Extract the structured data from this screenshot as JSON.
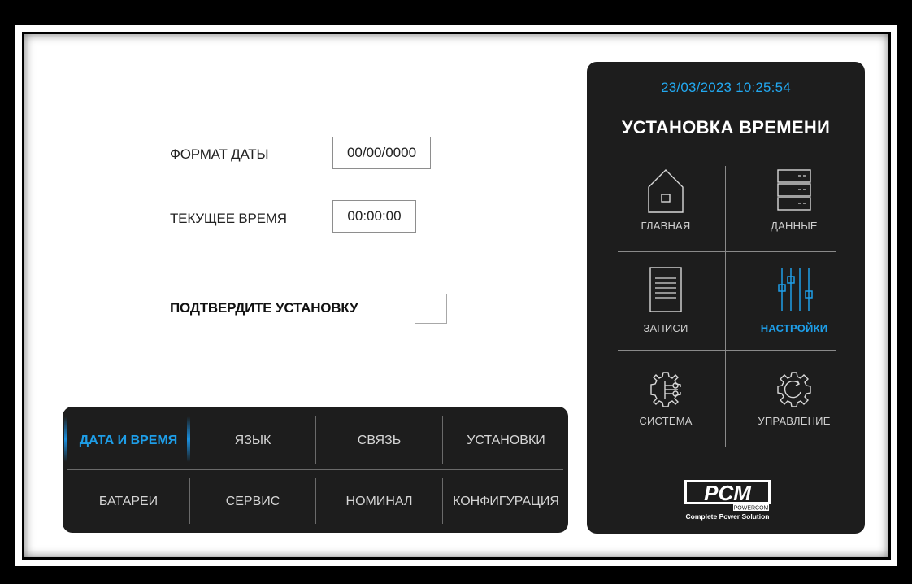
{
  "form": {
    "date_format_label": "ФОРМАТ ДАТЫ",
    "date_format_value": "00/00/0000",
    "current_time_label": "ТЕКУЩЕЕ ВРЕМЯ",
    "current_time_value": "00:00:00",
    "confirm_label": "ПОДТВЕРДИТЕ УСТАНОВКУ",
    "confirm_checked": false
  },
  "tabs": {
    "row1": [
      "ДАТА И ВРЕМЯ",
      "ЯЗЫК",
      "СВЯЗЬ",
      "УСТАНОВКИ"
    ],
    "row2": [
      "БАТАРЕИ",
      "СЕРВИС",
      "НОМИНАЛ",
      "КОНФИГУРАЦИЯ"
    ],
    "active": "ДАТА И ВРЕМЯ"
  },
  "nav": {
    "datetime": "23/03/2023  10:25:54",
    "title": "УСТАНОВКА ВРЕМЕНИ",
    "items": [
      {
        "label": "ГЛАВНАЯ",
        "icon": "home-icon"
      },
      {
        "label": "ДАННЫЕ",
        "icon": "data-rack-icon"
      },
      {
        "label": "ЗАПИСИ",
        "icon": "document-icon"
      },
      {
        "label": "НАСТРОЙКИ",
        "icon": "sliders-icon"
      },
      {
        "label": "СИСТЕМА",
        "icon": "system-gear-icon"
      },
      {
        "label": "УПРАВЛЕНИЕ",
        "icon": "control-gear-icon"
      }
    ],
    "active": "НАСТРОЙКИ"
  },
  "logo": {
    "mark": "PCM",
    "brand": "POWERCOM",
    "tagline": "Complete Power Solution"
  },
  "colors": {
    "accent": "#1e9ee8",
    "panel_bg": "#1d1d1d",
    "datetime": "#22a8f0"
  }
}
